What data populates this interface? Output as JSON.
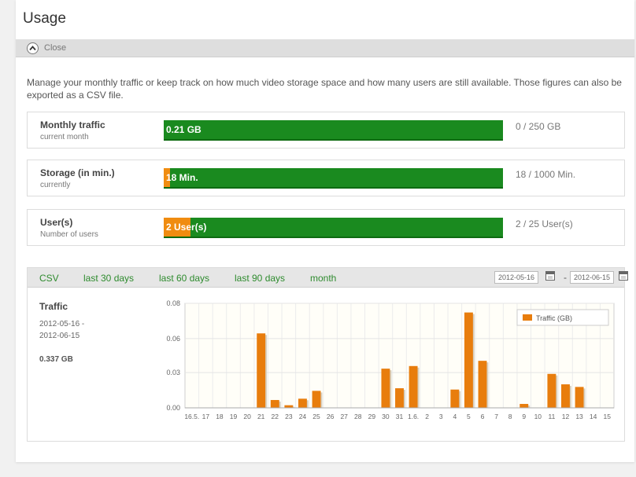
{
  "page": {
    "title": "Usage"
  },
  "close_bar": {
    "label": "Close",
    "icon": "chevron-up-icon"
  },
  "intro": "Manage your monthly traffic or keep track on how much video storage space and how many users are still available. Those figures can also be exported as a CSV file.",
  "usage_rows": [
    {
      "title": "Monthly traffic",
      "subtitle": "current month",
      "bar_label": "0.21 GB",
      "value": "0 / 250 GB",
      "used_fraction": 0.0
    },
    {
      "title": "Storage (in min.)",
      "subtitle": "currently",
      "bar_label": "18 Min.",
      "value": "18 / 1000 Min.",
      "used_fraction": 0.018
    },
    {
      "title": "User(s)",
      "subtitle": "Number of users",
      "bar_label": "2 User(s)",
      "value": "2 / 25 User(s)",
      "used_fraction": 0.08
    }
  ],
  "colors": {
    "bar_free": "#1a8a1f",
    "bar_used": "#f08c10",
    "link_green": "#2e8b2e",
    "chart_bar": "#e87d0d"
  },
  "filters": {
    "csv": "CSV",
    "last30": "last 30 days",
    "last60": "last 60 days",
    "last90": "last 90 days",
    "month": "month",
    "date_from": "2012-05-16",
    "date_to": "2012-06-15",
    "separator": "-"
  },
  "stats": {
    "title": "Traffic",
    "range_line1": "2012-05-16 -",
    "range_line2": "2012-06-15",
    "total": "0.337 GB"
  },
  "chart_data": {
    "type": "bar",
    "categories": [
      "16.5.",
      "17",
      "18",
      "19",
      "20",
      "21",
      "22",
      "23",
      "24",
      "25",
      "26",
      "27",
      "28",
      "29",
      "30",
      "31",
      "1.6.",
      "2",
      "3",
      "4",
      "5",
      "6",
      "7",
      "8",
      "9",
      "10",
      "11",
      "12",
      "13",
      "14",
      "15"
    ],
    "series": [
      {
        "name": "Traffic (GB)",
        "values": [
          0,
          0,
          0,
          0,
          0,
          0.057,
          0.006,
          0.002,
          0.007,
          0.013,
          0,
          0,
          0,
          0,
          0.03,
          0.015,
          0.032,
          0,
          0,
          0.014,
          0.073,
          0.036,
          0,
          0,
          0.003,
          0,
          0.026,
          0.018,
          0.016,
          0,
          0
        ]
      }
    ],
    "y_ticks": [
      "0.00",
      "0.03",
      "0.06",
      "0.08"
    ],
    "y_tick_values": [
      0,
      0.027,
      0.053,
      0.08
    ],
    "ylim": [
      0,
      0.08
    ],
    "grid": true,
    "legend_position": "top-right"
  }
}
